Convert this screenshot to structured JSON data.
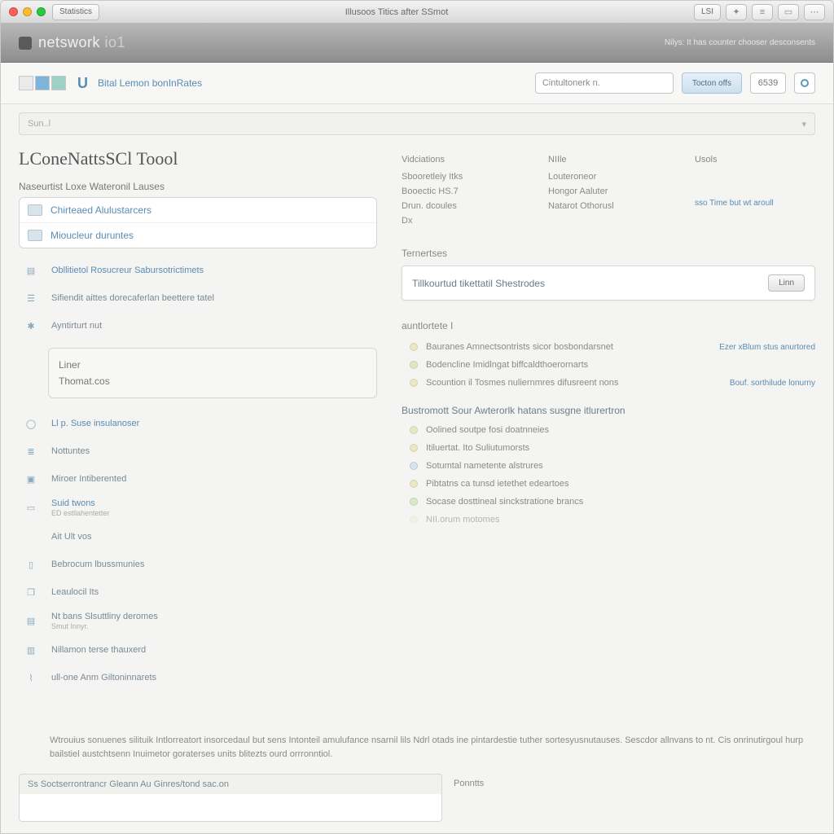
{
  "titlebar": {
    "back_label": "Statistics",
    "center": "Illusoos Titics after SSmot",
    "right_label": "LSI"
  },
  "banner": {
    "title_a": "netswork",
    "title_b": "io1",
    "subtitle": "Nilys: It has counter chooser desconsents"
  },
  "subhead": {
    "letter": "U",
    "brand": "Bital Lemon bonInRates",
    "search_placeholder": "Cintultonerk n.",
    "action": "Tocton offs",
    "count": "6539"
  },
  "secbar": {
    "label": "Sun..l"
  },
  "page": {
    "title": "LConeNattsSCl Toool",
    "section": "Naseurtist Loxe Wateronil Lauses"
  },
  "card": {
    "items": [
      "Chirteaed Alulustarcers",
      "Mioucleur duruntes"
    ]
  },
  "infobox": {
    "lines": [
      "Liner",
      "Thomat.cos"
    ]
  },
  "nav": {
    "items": [
      {
        "label": "Obllitietol Rosucreur Sabursotrictimets",
        "link": true
      },
      {
        "label": "Sifiendit aittes dorecaferlan beettere tatel",
        "link": false
      },
      {
        "label": "Ayntirturt nut",
        "link": false
      },
      {
        "label": "Ll p. Suse insulanoser",
        "link": true
      },
      {
        "label": "Nottuntes",
        "link": false
      },
      {
        "label": "Miroer Intiberented",
        "link": false
      },
      {
        "label": "Suid twons",
        "sub": "ED estllahentetter",
        "link": true
      },
      {
        "label": "Ait Ult vos",
        "link": false
      },
      {
        "label": "Bebrocum lbussmunies",
        "link": false
      },
      {
        "label": "Leaulocil Its",
        "link": false
      },
      {
        "label": "Nt bans Slsuttliny deromes",
        "sub": "Smut Innyr.",
        "link": false
      },
      {
        "label": "Nillamon terse thauxerd",
        "link": false
      },
      {
        "label": "ull-one Anm Giltoninnarets",
        "link": false
      }
    ]
  },
  "right": {
    "cols": [
      {
        "head": "Vidciations",
        "items": [
          "Sbooretleiy Itks",
          "Booectic HS.7",
          "Drun. dcoules",
          "Dx"
        ]
      },
      {
        "head": "NIIle",
        "items": [
          "Louteroneor",
          "Hongor Aaluter",
          "Natarot Othorusl"
        ]
      },
      {
        "head": "Usols",
        "items": [
          ""
        ]
      }
    ],
    "side_link": "sso Time but wt aroull",
    "panel1_head": "Ternertses",
    "panel1_title": "Tillkourtud tikettatil Shestrodes",
    "panel1_btn": "Linn",
    "panel2_head": "auntlortete I",
    "bullets1": [
      {
        "text": "Bauranes Amnectsontrists sicor bosbondarsnet",
        "link": "Ezer  xBlum stus  anurtored"
      },
      {
        "text": "Bodencline Imidlngat biffcaldthoerornarts",
        "link": ""
      },
      {
        "text": "Scountion il Tosmes nuliernmres difusreent nons",
        "link": "Bouf.  sorthilude lonurny"
      }
    ],
    "sub_section": "Bustromott Sour Awterorlk hatans susgne itlurertron",
    "bullets2": [
      {
        "text": "Oolined soutpe fosi doatnneies"
      },
      {
        "text": "Itiluertat. Ito Suliutumorsts"
      },
      {
        "text": "Sotumtal nametente alstrures"
      },
      {
        "text": "Pibtatns ca tunsd ietethet edeartoes"
      },
      {
        "text": "Socase dosttineal sinckstratione brancs"
      },
      {
        "text": "NII.orum motomes"
      }
    ]
  },
  "desc": "Wtrouius sonuenes silituik Intlorreatort insorcedaul but sens Intonteil amulufance nsarnil lils Ndrl otads ine pintardestie tuther sortesyusnutauses. Sescdor allnvans to nt. Cis onrinutirgoul hurp bailstiel austchtsenn Inuimetor goraterses units blitezts ourd orrronntiol.",
  "footer": {
    "title": "Ss Soctserrontrancr Gleann Au Ginres/tond sac.on",
    "side": "Ponntts"
  }
}
